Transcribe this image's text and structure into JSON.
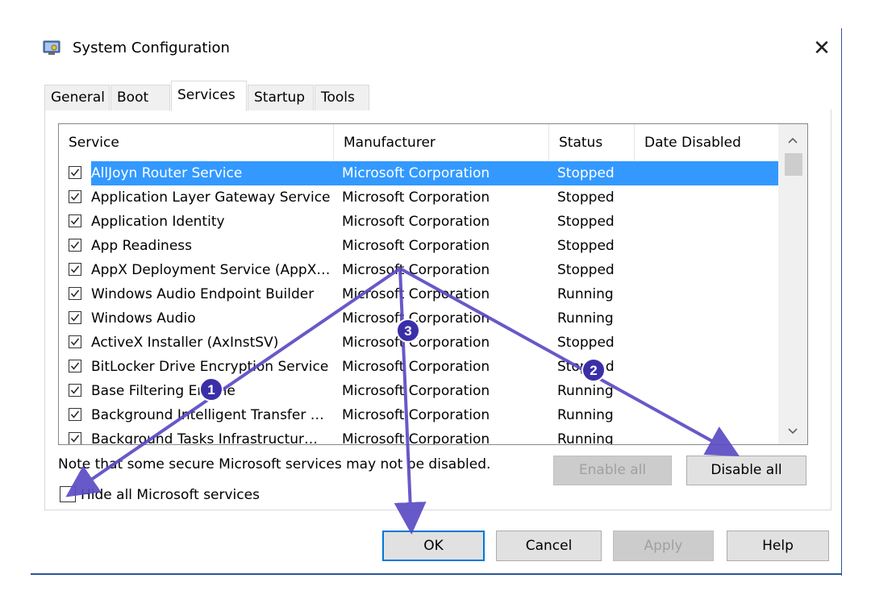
{
  "window": {
    "title": "System Configuration",
    "close_glyph": "✕",
    "icon": "system-config-icon"
  },
  "tabs": [
    {
      "label": "General",
      "active": false
    },
    {
      "label": "Boot",
      "active": false
    },
    {
      "label": "Services",
      "active": true
    },
    {
      "label": "Startup",
      "active": false
    },
    {
      "label": "Tools",
      "active": false
    }
  ],
  "table": {
    "columns": [
      "Service",
      "Manufacturer",
      "Status",
      "Date Disabled"
    ],
    "rows": [
      {
        "name": "AllJoyn Router Service",
        "manufacturer": "Microsoft Corporation",
        "status": "Stopped",
        "checked": true,
        "selected": true
      },
      {
        "name": "Application Layer Gateway Service",
        "manufacturer": "Microsoft Corporation",
        "status": "Stopped",
        "checked": true
      },
      {
        "name": "Application Identity",
        "manufacturer": "Microsoft Corporation",
        "status": "Stopped",
        "checked": true
      },
      {
        "name": "App Readiness",
        "manufacturer": "Microsoft Corporation",
        "status": "Stopped",
        "checked": true
      },
      {
        "name": "AppX Deployment Service (AppX…",
        "manufacturer": "Microsoft Corporation",
        "status": "Stopped",
        "checked": true
      },
      {
        "name": "Windows Audio Endpoint Builder",
        "manufacturer": "Microsoft Corporation",
        "status": "Running",
        "checked": true
      },
      {
        "name": "Windows Audio",
        "manufacturer": "Microsoft Corporation",
        "status": "Running",
        "checked": true
      },
      {
        "name": "ActiveX Installer (AxInstSV)",
        "manufacturer": "Microsoft Corporation",
        "status": "Stopped",
        "checked": true
      },
      {
        "name": "BitLocker Drive Encryption Service",
        "manufacturer": "Microsoft Corporation",
        "status": "Stopped",
        "checked": true
      },
      {
        "name": "Base Filtering Engine",
        "manufacturer": "Microsoft Corporation",
        "status": "Running",
        "checked": true
      },
      {
        "name": "Background Intelligent Transfer …",
        "manufacturer": "Microsoft Corporation",
        "status": "Running",
        "checked": true
      },
      {
        "name": "Background Tasks Infrastructur…",
        "manufacturer": "Microsoft Corporation",
        "status": "Running",
        "checked": true
      }
    ],
    "scroll_up": "^",
    "scroll_down": "v"
  },
  "note": "Note that some secure Microsoft services may not be disabled.",
  "hide_ms": {
    "label": "Hide all Microsoft services",
    "checked": false
  },
  "buttons": {
    "enable_all": "Enable all",
    "disable_all": "Disable all",
    "ok": "OK",
    "cancel": "Cancel",
    "apply": "Apply",
    "help": "Help"
  },
  "annotations": {
    "color": "#5b4bc4",
    "badges": [
      "1",
      "2",
      "3"
    ]
  }
}
